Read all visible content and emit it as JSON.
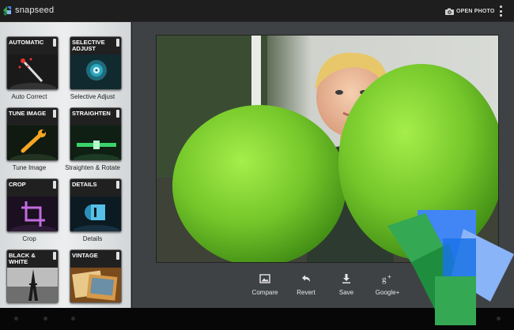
{
  "app": {
    "name": "snapseed"
  },
  "toolbar": {
    "open_photo_label": "OPEN PHOTO"
  },
  "tools": [
    {
      "tile_title": "AUTOMATIC",
      "caption": "Auto Correct",
      "icon": "magic-wand-icon"
    },
    {
      "tile_title": "SELECTIVE ADJUST",
      "caption": "Selective Adjust",
      "icon": "control-point-icon"
    },
    {
      "tile_title": "TUNE IMAGE",
      "caption": "Tune Image",
      "icon": "wrench-icon"
    },
    {
      "tile_title": "STRAIGHTEN",
      "caption": "Straighten & Rotate",
      "icon": "level-icon"
    },
    {
      "tile_title": "CROP",
      "caption": "Crop",
      "icon": "crop-icon"
    },
    {
      "tile_title": "DETAILS",
      "caption": "Details",
      "icon": "sharpen-icon"
    },
    {
      "tile_title": "BLACK & WHITE",
      "caption": "",
      "icon": "eiffel-tower-icon"
    },
    {
      "tile_title": "VINTAGE",
      "caption": "",
      "icon": "vintage-photo-icon"
    }
  ],
  "actions": [
    {
      "label": "Compare",
      "icon": "compare-image-icon"
    },
    {
      "label": "Revert",
      "icon": "revert-arrow-icon"
    },
    {
      "label": "Save",
      "icon": "save-download-icon"
    },
    {
      "label": "Google+",
      "icon": "google-plus-icon"
    }
  ],
  "colors": {
    "balloon_green": "#7ed321",
    "logo_green": "#34a853",
    "logo_dark_green": "#1e8e3e",
    "logo_blue": "#4285f4",
    "logo_light_blue": "#8ab4f8",
    "toolbar_bg": "#1e1e1e",
    "canvas_bg": "#3f4245"
  }
}
